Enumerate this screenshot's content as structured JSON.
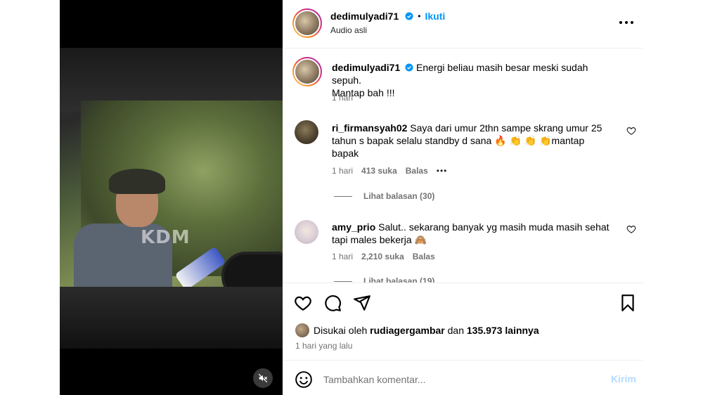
{
  "post": {
    "author": "dedimulyadi71",
    "follow_label": "Ikuti",
    "dot": "•",
    "audio_label": "Audio asli",
    "caption_line1": "Energi beliau masih besar meski sudah sepuh.",
    "caption_line2": "Mantap bah !!!",
    "caption_time": "1 hari",
    "video_watermark": "KDM"
  },
  "comments": [
    {
      "username": "ri_firmansyah02",
      "text_line1": "Saya dari umur 2thn sampe skrang umur 25",
      "text_line2": "tahun s bapak selalu standby d sana 🔥 👏 👏 👏mantap",
      "text_line3": "bapak",
      "time": "1 hari",
      "likes": "413 suka",
      "reply_label": "Balas",
      "more": "•••",
      "view_replies": "Lihat balasan (30)"
    },
    {
      "username": "amy_prio",
      "text_line1": "Salut.. sekarang banyak yg masih muda masih sehat",
      "text_line2": "tapi males bekerja 🙈",
      "time": "1 hari",
      "likes": "2,210 suka",
      "reply_label": "Balas",
      "view_replies": "Lihat balasan (19)"
    }
  ],
  "likes_summary": {
    "prefix": "Disukai oleh",
    "liker": "rudiagergambar",
    "middle": "dan",
    "count_text": "135.973 lainnya",
    "time_ago": "1 hari yang lalu"
  },
  "composer": {
    "placeholder": "Tambahkan komentar...",
    "post_label": "Kirim"
  },
  "colors": {
    "accent": "#0095f6",
    "verified": "#0095f6",
    "muted": "#737373",
    "post_disabled": "#b3dbff"
  },
  "icons": [
    "verified-icon",
    "more-options-icon",
    "heart-icon",
    "comment-icon",
    "share-icon",
    "bookmark-icon",
    "emoji-icon",
    "mute-icon"
  ]
}
